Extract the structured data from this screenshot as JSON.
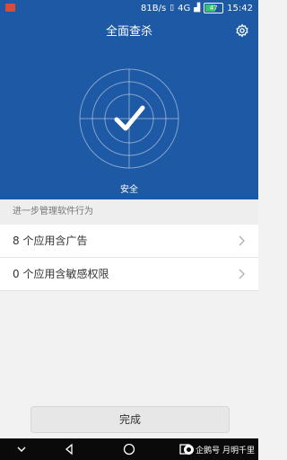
{
  "status_bar": {
    "speed": "81B/s",
    "network_4g": "4G",
    "battery": "47",
    "time": "15:42"
  },
  "header": {
    "title": "全面查杀"
  },
  "scan": {
    "status_label": "安全"
  },
  "section": {
    "title": "进一步管理软件行为"
  },
  "list": {
    "items": [
      {
        "label": "8 个应用含广告"
      },
      {
        "label": "0 个应用含敏感权限"
      }
    ]
  },
  "footer": {
    "done_label": "完成"
  },
  "watermark": {
    "text": "企鹅号 月明千里"
  },
  "colors": {
    "hero_bg": "#1d59a4",
    "battery_fill": "#38c46b"
  }
}
